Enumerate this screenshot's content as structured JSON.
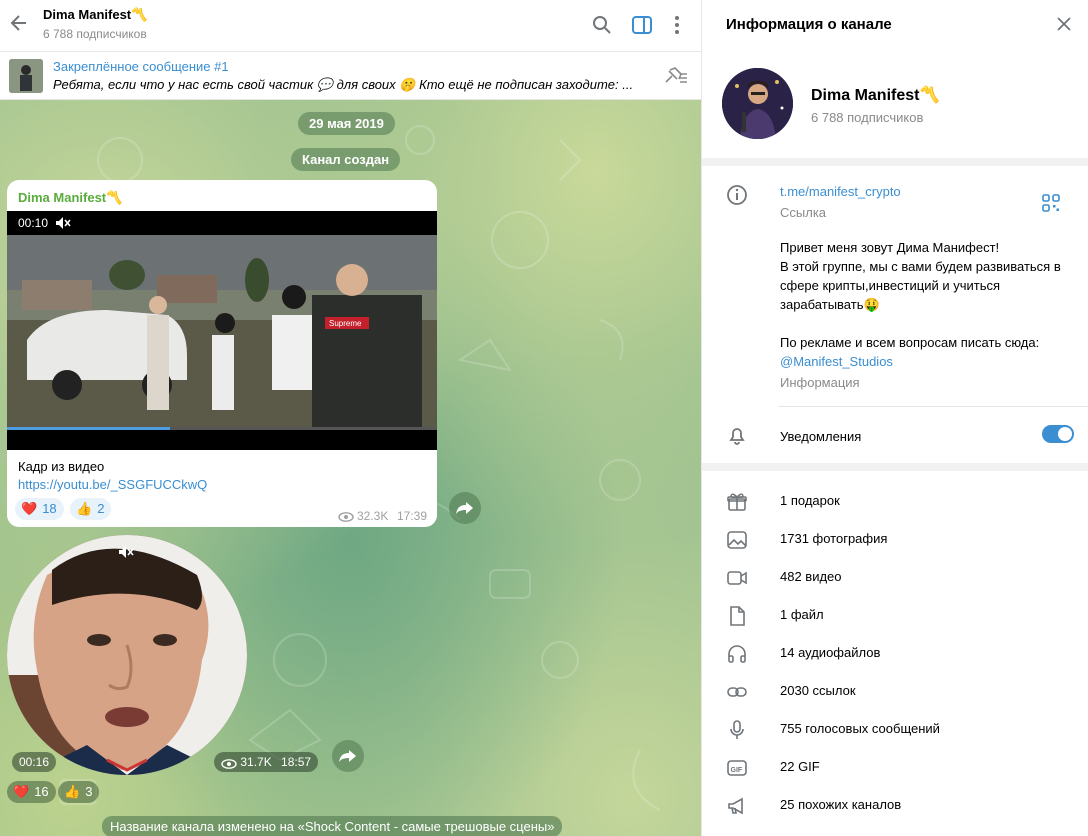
{
  "header": {
    "title": "Dima Manifest〽️",
    "subscribers": "6 788 подписчиков"
  },
  "pinned": {
    "title": "Закреплённое сообщение #1",
    "text": "Ребята, если что у нас есть свой частик 💬 для своих 🤫 Кто ещё не подписан заходите: ..."
  },
  "chat": {
    "date_pill": "29 мая 2019",
    "created_pill": "Канал создан",
    "post1": {
      "author": "Dima Manifest〽️",
      "video_time": "00:10",
      "caption": "Кадр из видео",
      "link": "https://youtu.be/_SSGFUCCkwQ",
      "progress_fraction": 0.38,
      "reactions": [
        {
          "emoji": "❤️",
          "count": "18"
        },
        {
          "emoji": "👍",
          "count": "2"
        }
      ],
      "views": "32.3K",
      "time": "17:39"
    },
    "post2": {
      "duration": "00:16",
      "views": "31.7K",
      "time": "18:57",
      "reactions": [
        {
          "emoji": "❤️",
          "count": "16"
        },
        {
          "emoji": "👍",
          "count": "3"
        }
      ]
    },
    "service_message": "Название канала изменено на «Shock Content - самые трешовые сцены»"
  },
  "info": {
    "header": "Информация о канале",
    "name": "Dima Manifest〽️",
    "subscribers": "6 788 подписчиков",
    "link": "t.me/manifest_crypto",
    "link_label": "Ссылка",
    "about_main": "Привет меня зовут Дима Манифест!\nВ этой группе, мы с вами будем развиваться в сфере крипты,инвестиций и учиться зарабатывать🤑\n\nПо рекламе и всем вопросам писать сюда:",
    "about_link": "@Manifest_Studios",
    "about_label": "Информация",
    "notifications_label": "Уведомления",
    "notifications_on": true,
    "media": [
      {
        "icon": "gift-icon",
        "label": "1 подарок"
      },
      {
        "icon": "photo-icon",
        "label": "1731 фотография"
      },
      {
        "icon": "video-icon",
        "label": "482 видео"
      },
      {
        "icon": "file-icon",
        "label": "1 файл"
      },
      {
        "icon": "headphones-icon",
        "label": "14 аудиофайлов"
      },
      {
        "icon": "link-icon",
        "label": "2030 ссылок"
      },
      {
        "icon": "microphone-icon",
        "label": "755 голосовых сообщений"
      },
      {
        "icon": "gif-icon",
        "label": "22 GIF"
      },
      {
        "icon": "megaphone-icon",
        "label": "25 похожих каналов"
      }
    ]
  },
  "colors": {
    "accent": "#3a8ed1",
    "author": "#5aac3c",
    "reaction_bg": "#e7f2fb"
  }
}
